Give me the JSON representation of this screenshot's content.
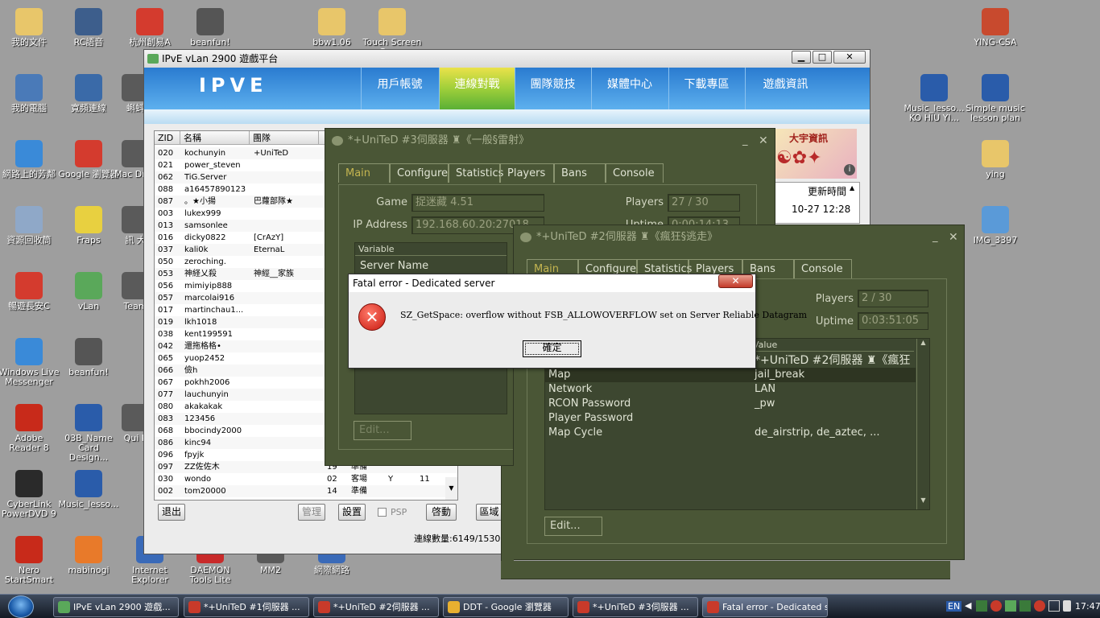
{
  "desktop": {
    "icons": [
      {
        "label": "我的文件",
        "icon": "documents-folder-icon",
        "color": "#e8c66a"
      },
      {
        "label": "RC語音",
        "icon": "rc-voice-icon",
        "color": "#3d5e8c"
      },
      {
        "label": "杭州創易A",
        "icon": "chrome-icon",
        "color": "#d43b2e"
      },
      {
        "label": "beanfun!",
        "icon": "beanfun-icon",
        "color": "#555555"
      },
      {
        "label": "bbw1.06",
        "icon": "folder-icon",
        "color": "#e8c66a"
      },
      {
        "label": "Touch Screen Game",
        "icon": "folder-icon",
        "color": "#e8c66a"
      },
      {
        "label": "YING-CSA",
        "icon": "image-icon",
        "color": "#c84a2e"
      },
      {
        "label": "我的電腦",
        "icon": "computer-icon",
        "color": "#4a7ab8"
      },
      {
        "label": "寬頻連線",
        "icon": "network-icon",
        "color": "#3a6aa8"
      },
      {
        "label": "蝌蚪",
        "icon": "app-icon",
        "color": "#5a5a5a"
      },
      {
        "label": "Music_lesso... KO HIU YI...",
        "icon": "word-doc-icon",
        "color": "#2a5caa"
      },
      {
        "label": "Simple music lesson plan",
        "icon": "word-doc-icon",
        "color": "#2a5caa"
      },
      {
        "label": "網路上的芳鄰",
        "icon": "network-places-icon",
        "color": "#3a8ad8"
      },
      {
        "label": "Google 瀏覽器",
        "icon": "chrome-icon",
        "color": "#d43b2e"
      },
      {
        "label": "Mac Drea",
        "icon": "app-icon",
        "color": "#5a5a5a"
      },
      {
        "label": "ying",
        "icon": "folder-icon",
        "color": "#e8c66a"
      },
      {
        "label": "資源回收筒",
        "icon": "recycle-bin-icon",
        "color": "#8fa8c8"
      },
      {
        "label": "Fraps",
        "icon": "fraps-icon",
        "color": "#e8d040"
      },
      {
        "label": "訊 大",
        "icon": "app-icon",
        "color": "#5a5a5a"
      },
      {
        "label": "IMG_3397",
        "icon": "image-icon",
        "color": "#5a9ad8"
      },
      {
        "label": "暢遊長安C",
        "icon": "chrome-icon",
        "color": "#d43b2e"
      },
      {
        "label": "vLan",
        "icon": "vlan-icon",
        "color": "#5aa85a"
      },
      {
        "label": "Team",
        "icon": "app-icon",
        "color": "#5a5a5a"
      },
      {
        "label": "Windows Live Messenger",
        "icon": "messenger-icon",
        "color": "#3a8ad8"
      },
      {
        "label": "beanfun!",
        "icon": "beanfun-icon",
        "color": "#555555"
      },
      {
        "label": "Adobe Reader 8",
        "icon": "adobe-reader-icon",
        "color": "#c82a1a"
      },
      {
        "label": "03B_Name Card Design...",
        "icon": "word-doc-icon",
        "color": "#2a5caa"
      },
      {
        "label": "Qui P",
        "icon": "app-icon",
        "color": "#5a5a5a"
      },
      {
        "label": "CyberLink PowerDVD 9",
        "icon": "powerdvd-icon",
        "color": "#2a2a2a"
      },
      {
        "label": "Music_lesso...",
        "icon": "word-doc-icon",
        "color": "#2a5caa"
      },
      {
        "label": "Nero StartSmart",
        "icon": "nero-icon",
        "color": "#c82a1a"
      },
      {
        "label": "mabinogi",
        "icon": "mabinogi-icon",
        "color": "#e87a2a"
      },
      {
        "label": "Internet Explorer",
        "icon": "ie-icon",
        "color": "#3a6ab8"
      },
      {
        "label": "DAEMON Tools Lite",
        "icon": "daemon-tools-icon",
        "color": "#c82a2a"
      },
      {
        "label": "MM2",
        "icon": "app-icon",
        "color": "#5a5a5a"
      },
      {
        "label": "網際網路",
        "icon": "ie-icon",
        "color": "#3a6ab8"
      }
    ]
  },
  "ipve": {
    "title": "IPvE vLan 2900 遊戲平台",
    "logo": "IPVE",
    "nav": [
      "用戶帳號",
      "連線對戰",
      "團隊競技",
      "媒體中心",
      "下載專區",
      "遊戲資訊"
    ],
    "nav_active": 1,
    "table_headers": [
      "ZID",
      "名稱",
      "團隊",
      ""
    ],
    "users": [
      {
        "zid": "020",
        "name": "kochunyin",
        "team": "+UniTeD"
      },
      {
        "zid": "021",
        "name": "power_steven",
        "team": ""
      },
      {
        "zid": "062",
        "name": "TiG.Server",
        "team": ""
      },
      {
        "zid": "088",
        "name": "a16457890123",
        "team": ""
      },
      {
        "zid": "087",
        "name": "。★小揚",
        "team": "巴蘿部隊★"
      },
      {
        "zid": "003",
        "name": "lukex999",
        "team": ""
      },
      {
        "zid": "013",
        "name": "samsonlee",
        "team": ""
      },
      {
        "zid": "016",
        "name": "dicky0822",
        "team": "[CrAzY]"
      },
      {
        "zid": "037",
        "name": "kali0k",
        "team": "EternaL"
      },
      {
        "zid": "050",
        "name": "zeroching.",
        "team": ""
      },
      {
        "zid": "053",
        "name": "神経乂殺",
        "team": "神經__家族"
      },
      {
        "zid": "056",
        "name": "mimiyip888",
        "team": ""
      },
      {
        "zid": "057",
        "name": "marcolai916",
        "team": ""
      },
      {
        "zid": "017",
        "name": "martinchau1...",
        "team": ""
      },
      {
        "zid": "019",
        "name": "lkh1018",
        "team": ""
      },
      {
        "zid": "038",
        "name": "kent199591",
        "team": ""
      },
      {
        "zid": "042",
        "name": "還拖格格•",
        "team": ""
      },
      {
        "zid": "065",
        "name": "yuop2452",
        "team": ""
      },
      {
        "zid": "066",
        "name": "儉h",
        "team": ""
      },
      {
        "zid": "067",
        "name": "pokhh2006",
        "team": ""
      },
      {
        "zid": "077",
        "name": "lauchunyin",
        "team": ""
      },
      {
        "zid": "080",
        "name": "akakakak",
        "team": ""
      },
      {
        "zid": "083",
        "name": "123456",
        "team": ""
      },
      {
        "zid": "068",
        "name": "bbocindy2000",
        "team": ""
      },
      {
        "zid": "086",
        "name": "kinc94",
        "team": ""
      },
      {
        "zid": "096",
        "name": "fpyjk",
        "team": ""
      },
      {
        "zid": "097",
        "name": "ZZ佐佐木",
        "team": "",
        "c4": "19",
        "c5": "準備",
        "c6": "",
        "c7": ""
      },
      {
        "zid": "030",
        "name": "wondo",
        "team": "",
        "c4": "02",
        "c5": "客場",
        "c6": "Y",
        "c7": "11"
      },
      {
        "zid": "002",
        "name": "tom20000",
        "team": "",
        "c4": "14",
        "c5": "準備",
        "c6": "",
        "c7": ""
      }
    ],
    "buttons": {
      "exit": "退出",
      "manage": "管理",
      "settings": "設置",
      "psp": "PSP",
      "start": "啓動",
      "region": "區域"
    },
    "connections": "連線數量:6149/15300",
    "ad_text": "大宇資訊",
    "update_header": "更新時間",
    "update_value": "10-27 12:28"
  },
  "server3": {
    "title": "*+UniTeD #3伺服器 ♜《一般§雷射》",
    "tabs": [
      "Main",
      "Configure",
      "Statistics",
      "Players",
      "Bans",
      "Console"
    ],
    "game_label": "Game",
    "game_value": "捉迷藏 4.51",
    "players_label": "Players",
    "players_value": "27 / 30",
    "ip_label": "IP Address",
    "ip_value": "192.168.60.20:27018",
    "uptime_label": "Uptime",
    "uptime_value": "0:00:14:13",
    "list_header": "Variable",
    "list_row": "Server Name",
    "edit_button": "Edit..."
  },
  "server2": {
    "title": "*+UniTeD #2伺服器 ♜《瘋狂§逃走》",
    "tabs": [
      "Main",
      "Configure",
      "Statistics",
      "Players",
      "Bans",
      "Console"
    ],
    "players_label": "Players",
    "players_value": "2 / 30",
    "uptime_label": "Uptime",
    "uptime_value": "0:03:51:05",
    "value_header": "Value",
    "rows": [
      {
        "variable": "",
        "value": "*+UniTeD #2伺服器 ♜《瘋狂"
      },
      {
        "variable": "Map",
        "value": "jail_break"
      },
      {
        "variable": "Network",
        "value": "LAN"
      },
      {
        "variable": "RCON Password",
        "value": "_pw"
      },
      {
        "variable": "Player Password",
        "value": ""
      },
      {
        "variable": "Map Cycle",
        "value": "de_airstrip, de_aztec, ..."
      }
    ],
    "edit_button": "Edit..."
  },
  "error_dialog": {
    "title": "Fatal error - Dedicated server",
    "message": "SZ_GetSpace: overflow without FSB_ALLOWOVERFLOW set on Server Reliable Datagram",
    "ok_button": "確定",
    "close": "✕"
  },
  "taskbar": {
    "items": [
      {
        "label": "IPvE vLan 2900 遊戲...",
        "icon": "vlan-icon",
        "color": "#5aa85a"
      },
      {
        "label": "*+UniTeD #1伺服器 ...",
        "icon": "hl-server-icon",
        "color": "#c83a2a"
      },
      {
        "label": "*+UniTeD #2伺服器 ...",
        "icon": "hl-server-icon",
        "color": "#c83a2a"
      },
      {
        "label": "DDT - Google 瀏覽器",
        "icon": "chrome-icon",
        "color": "#e8b030"
      },
      {
        "label": "*+UniTeD #3伺服器 ...",
        "icon": "hl-server-icon",
        "color": "#c83a2a"
      },
      {
        "label": "Fatal error - Dedicated s...",
        "icon": "hl-server-icon",
        "color": "#c83a2a"
      }
    ],
    "active_index": 5,
    "lang": "EN",
    "clock": "17:47"
  }
}
